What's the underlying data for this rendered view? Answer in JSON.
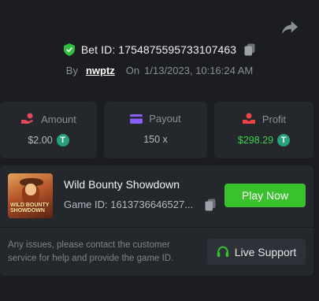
{
  "header": {
    "bet_id_label": "Bet ID: 1754875595733107463",
    "by_label": "By",
    "username": "nwptz",
    "on_label": "On",
    "datetime": "1/13/2023, 10:16:24 AM"
  },
  "icons": {
    "share": "share-icon",
    "verified": "shield-check-icon",
    "copy": "copy-icon",
    "amount": "coins-hand-icon",
    "payout": "wallet-icon",
    "profit": "hand-coin-icon",
    "currency": "tether-icon",
    "support": "headset-icon"
  },
  "stats": {
    "amount": {
      "label": "Amount",
      "value": "$2.00"
    },
    "payout": {
      "label": "Payout",
      "value": "150 x"
    },
    "profit": {
      "label": "Profit",
      "value": "$298.29"
    }
  },
  "game": {
    "thumbnail_logo": "WILD BOUNTY SHOWDOWN",
    "title": "Wild Bounty Showdown",
    "game_id": "Game ID: 1613736646527...",
    "play_label": "Play Now"
  },
  "support": {
    "message": "Any issues, please contact the customer service for help and provide the game ID.",
    "button_label": "Live Support"
  },
  "colors": {
    "background": "#1b1d21",
    "card": "#24272c",
    "accent_green": "#3ac12e",
    "profit_green": "#3fd14a",
    "amount_icon": "#e2475c",
    "payout_icon": "#8b5cf6",
    "profit_icon": "#ef4444",
    "tether": "#26a17b"
  }
}
